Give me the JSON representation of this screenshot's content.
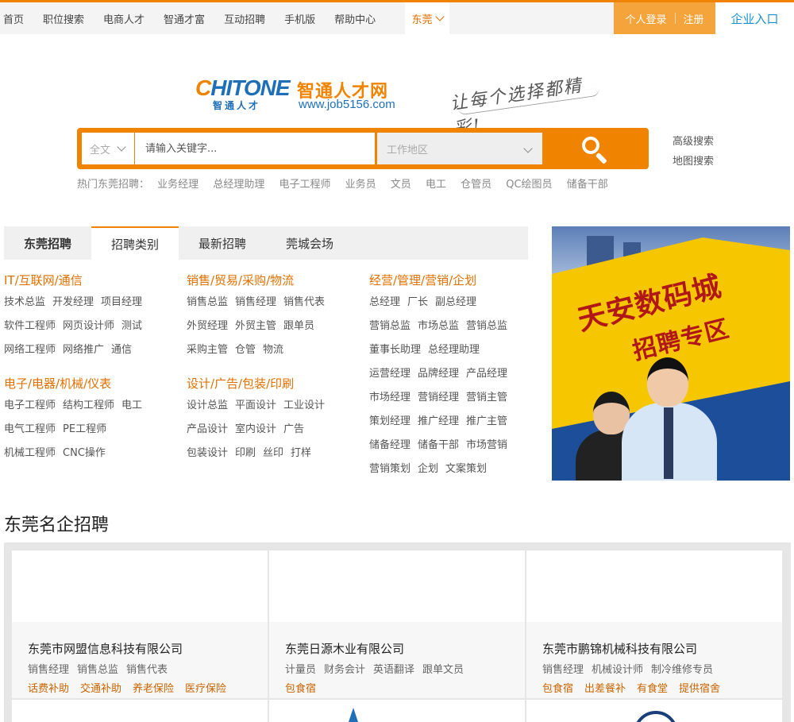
{
  "topnav": [
    "首页",
    "职位搜索",
    "电商人才",
    "智通才富",
    "互动招聘",
    "手机版",
    "帮助中心"
  ],
  "city": "东莞",
  "login": {
    "personal": "个人登录",
    "register": "注册",
    "enterprise": "企业入口"
  },
  "logo": {
    "en": "CHITONE",
    "cn_small": "智通人才",
    "cn": "智通人才网",
    "url": "www.job5156.com",
    "slogan": "让每个选择都精彩!"
  },
  "search": {
    "type": "全文",
    "placeholder": "请输入关键字...",
    "area": "工作地区",
    "advanced": "高级搜索",
    "map": "地图搜索"
  },
  "hot": {
    "label": "热门东莞招聘：",
    "items": [
      "业务经理",
      "总经理助理",
      "电子工程师",
      "业务员",
      "文员",
      "电工",
      "仓管员",
      "QC绘图员",
      "储备干部"
    ]
  },
  "tabs": [
    "东莞招聘",
    "招聘类别",
    "最新招聘",
    "莞城会场"
  ],
  "categories": [
    {
      "title": "IT/互联网/通信",
      "rows": [
        [
          "技术总监",
          "开发经理",
          "项目经理"
        ],
        [
          "软件工程师",
          "网页设计师",
          "测试"
        ],
        [
          "网络工程师",
          "网络推广",
          "通信"
        ]
      ]
    },
    {
      "title": "电子/电器/机械/仪表",
      "rows": [
        [
          "电子工程师",
          "结构工程师",
          "电工"
        ],
        [
          "电气工程师",
          "PE工程师"
        ],
        [
          "机械工程师",
          "CNC操作"
        ]
      ]
    },
    {
      "title": "销售/贸易/采购/物流",
      "rows": [
        [
          "销售总监",
          "销售经理",
          "销售代表"
        ],
        [
          "外贸经理",
          "外贸主管",
          "跟单员"
        ],
        [
          "采购主管",
          "仓管",
          "物流"
        ]
      ]
    },
    {
      "title": "设计/广告/包装/印刷",
      "rows": [
        [
          "设计总监",
          "平面设计",
          "工业设计"
        ],
        [
          "产品设计",
          "室内设计",
          "广告"
        ],
        [
          "包装设计",
          "印刷",
          "丝印",
          "打样"
        ]
      ]
    },
    {
      "title": "经营/管理/营销/企划",
      "rows": [
        [
          "总经理",
          "厂长",
          "副总经理"
        ],
        [
          "营销总监",
          "市场总监",
          "营销总监"
        ],
        [
          "董事长助理",
          "总经理助理"
        ],
        [
          "运营经理",
          "品牌经理",
          "产品经理"
        ],
        [
          "市场经理",
          "营销经理",
          "营销主管"
        ],
        [
          "策划经理",
          "推广经理",
          "推广主管"
        ],
        [
          "储备经理",
          "储备干部",
          "市场营销"
        ],
        [
          "营销策划",
          "企划",
          "文案策划"
        ]
      ]
    }
  ],
  "banner": {
    "line1": "天安数码城",
    "line2": "招聘专区"
  },
  "famous": {
    "title": "东莞名企招聘",
    "companies": [
      {
        "name": "东莞市网盟信息科技有限公司",
        "jobs": [
          "销售经理",
          "销售总监",
          "销售代表"
        ],
        "welfare": [
          "话费补助",
          "交通补助",
          "养老保险",
          "医疗保险"
        ]
      },
      {
        "name": "东莞日源木业有限公司",
        "jobs": [
          "计量员",
          "财务会计",
          "英语翻译",
          "跟单文员"
        ],
        "welfare": [
          "包食宿"
        ]
      },
      {
        "name": "东莞市鹏锦机械科技有限公司",
        "jobs": [
          "销售经理",
          "机械设计师",
          "制冷维修专员"
        ],
        "welfare": [
          "包食宿",
          "出差餐补",
          "有食堂",
          "提供宿舍"
        ]
      }
    ]
  },
  "colors": {
    "accent": "#f08300",
    "link_blue": "#1a8fd1",
    "category_orange": "#e07000"
  }
}
